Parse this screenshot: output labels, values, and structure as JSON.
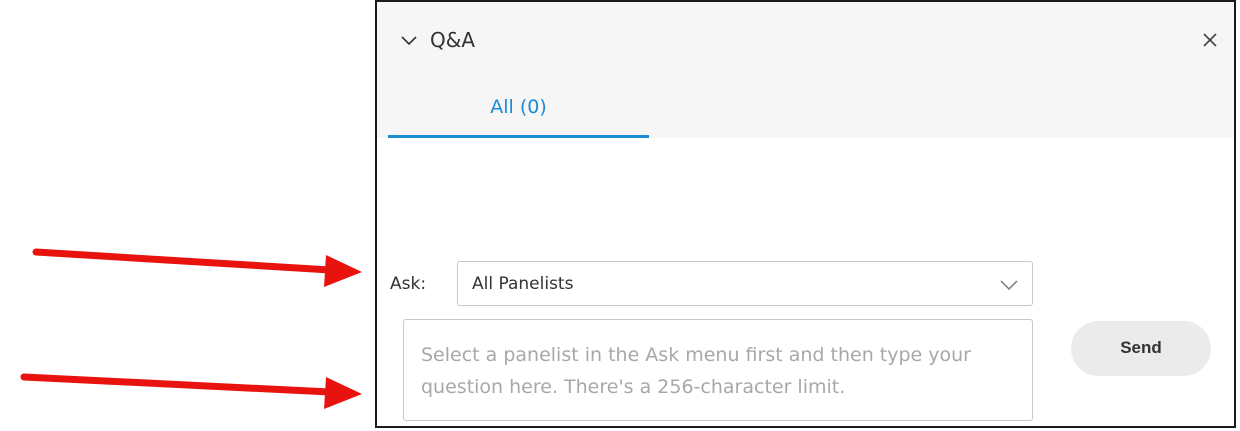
{
  "panel": {
    "title": "Q&A",
    "icons": {
      "collapse": "chevron-down-icon",
      "close": "close-icon"
    }
  },
  "tabs": [
    {
      "label": "All (0)",
      "active": true
    }
  ],
  "ask": {
    "label": "Ask:",
    "selected": "All Panelists",
    "dropdown_icon": "chevron-down-icon"
  },
  "question": {
    "value": "",
    "placeholder": "Select a panelist in the Ask menu first and then type your question here. There's a 256-character limit."
  },
  "send_button": {
    "label": "Send"
  },
  "colors": {
    "accent": "#1a8dd6",
    "arrow": "#e8130f",
    "header_bg": "#f6f6f6",
    "button_bg": "#ebebeb",
    "border": "#c8c8c8"
  }
}
